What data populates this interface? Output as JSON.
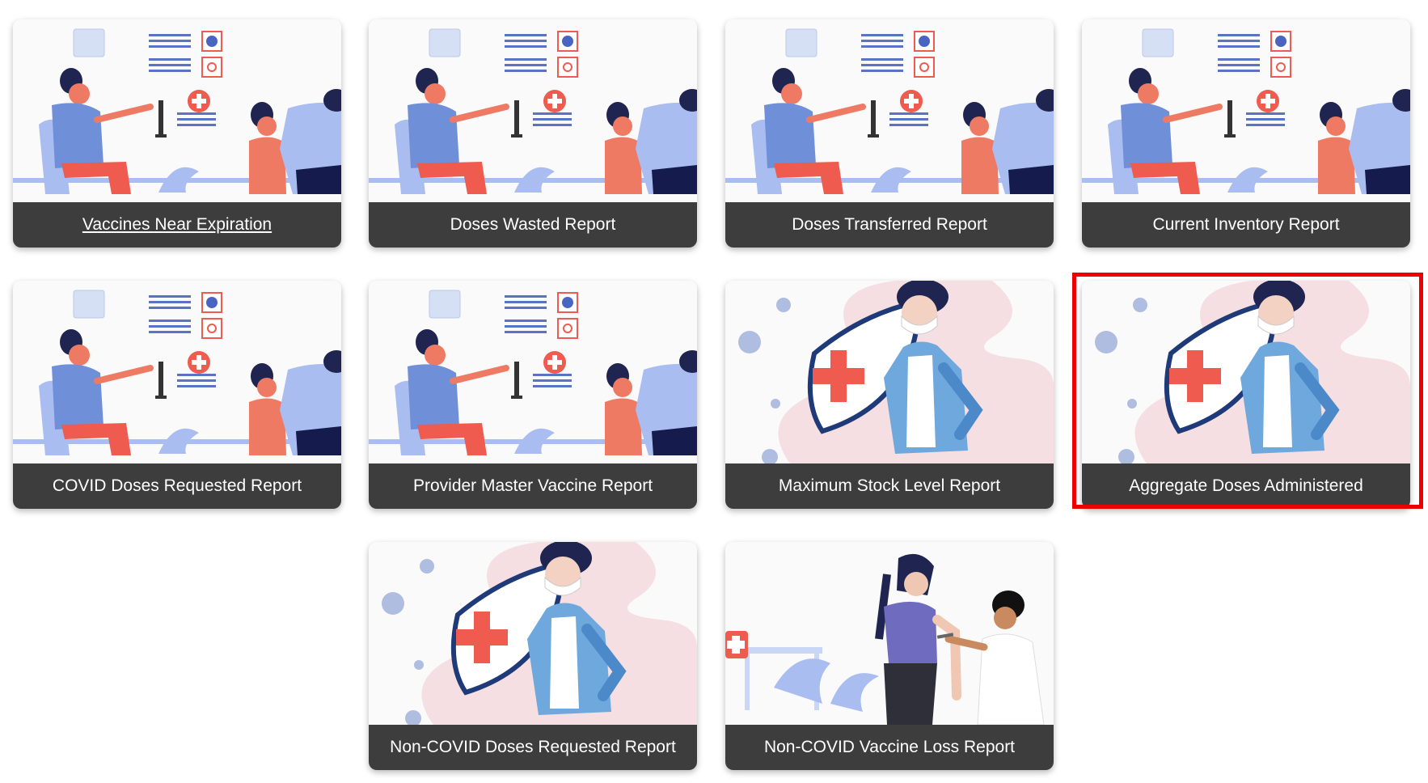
{
  "reports": [
    {
      "label": "Vaccines Near Expiration",
      "illustration": "clinic-vaccination-illustration",
      "underlined": true
    },
    {
      "label": "Doses Wasted Report",
      "illustration": "clinic-vaccination-illustration"
    },
    {
      "label": "Doses Transferred Report",
      "illustration": "clinic-vaccination-illustration"
    },
    {
      "label": "Current Inventory Report",
      "illustration": "clinic-vaccination-illustration"
    },
    {
      "label": "COVID Doses Requested Report",
      "illustration": "clinic-vaccination-illustration"
    },
    {
      "label": "Provider Master Vaccine Report",
      "illustration": "clinic-vaccination-illustration"
    },
    {
      "label": "Maximum Stock Level Report",
      "illustration": "masked-doctor-shield-illustration"
    },
    {
      "label": "Aggregate Doses Administered",
      "illustration": "masked-doctor-shield-illustration",
      "highlighted": true
    },
    {
      "label": "Non-COVID Doses Requested Report",
      "illustration": "masked-doctor-shield-illustration"
    },
    {
      "label": "Non-COVID Vaccine Loss Report",
      "illustration": "injection-illustration"
    }
  ],
  "colors": {
    "label_bar": "#3d3d3d",
    "highlight_border": "#ee0000",
    "accent_red": "#ef5b4e",
    "accent_blue": "#6f8fd8"
  }
}
